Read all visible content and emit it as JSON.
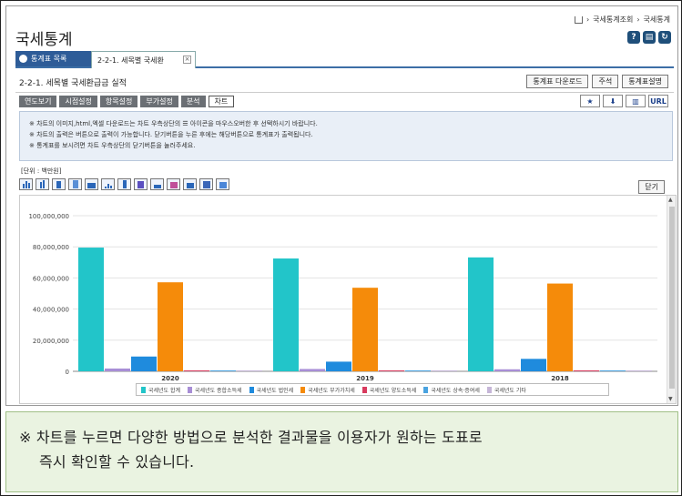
{
  "breadcrumb": {
    "items": [
      "국세통계조회",
      "국세통계"
    ]
  },
  "page_title": "국세통계",
  "top_icons": [
    "help-icon",
    "print-icon",
    "refresh-icon"
  ],
  "tabs": {
    "list_label": "통계표 목록",
    "active_label": "2-2-1. 세목별 국세환"
  },
  "subtitle": "2-2-1. 세목별 국세환급금 실적",
  "buttons": {
    "download": "통계표 다운로드",
    "annotation": "주석",
    "description": "통계표설명",
    "close": "닫기"
  },
  "menu_tabs": [
    "연도보기",
    "시점설정",
    "항목설정",
    "부가설정",
    "분석",
    "차트"
  ],
  "right_tools": {
    "url": "URL"
  },
  "notice": {
    "line1": "※ 차트의 이미지,html,엑셀 다운로드는 차트 우측상단의 ☰ 아이콘을 마우스오버한 후 선택하시기 바랍니다.",
    "line2": "※ 차트의 출력은 버튼으로 출력이 가능합니다. 닫기버튼을 누른 후에는 해당버튼으로 통계표가 출력됩니다.",
    "line3": "※ 통계표를 보시려면 차트 우측상단의 닫기버튼을 눌러주세요."
  },
  "unit": "[단위 : 백만원]",
  "chart_data": {
    "type": "bar",
    "categories": [
      "2020",
      "2019",
      "2018"
    ],
    "ylim": [
      0,
      100000000
    ],
    "yticks": [
      "100,000,000",
      "80,000,000",
      "60,000,000",
      "40,000,000",
      "20,000,000",
      "0"
    ],
    "series": [
      {
        "name": "국세년도 합계",
        "color": "#22c5c9",
        "values": [
          79500000,
          72500000,
          73200000
        ]
      },
      {
        "name": "국세년도 종합소득세",
        "color": "#a88ed6",
        "values": [
          1800000,
          1500000,
          1300000
        ]
      },
      {
        "name": "국세년도 법인세",
        "color": "#1f8bdd",
        "values": [
          9500000,
          6200000,
          8000000
        ]
      },
      {
        "name": "국세년도 부가가치세",
        "color": "#f58b0a",
        "values": [
          57200000,
          53700000,
          56400000
        ]
      },
      {
        "name": "국세년도 양도소득세",
        "color": "#d83a5e",
        "values": [
          300000,
          200000,
          200000
        ]
      },
      {
        "name": "국세년도 상속·증여세",
        "color": "#4aa3e0",
        "values": [
          200000,
          150000,
          150000
        ]
      },
      {
        "name": "국세년도 기타",
        "color": "#c6b6d8",
        "values": [
          200000,
          200000,
          200000
        ]
      }
    ]
  },
  "caption": {
    "line1": "※ 차트를 누르면 다양한 방법으로 분석한 결과물을 이용자가 원하는 도표로",
    "line2": "즉시 확인할 수 있습니다."
  }
}
